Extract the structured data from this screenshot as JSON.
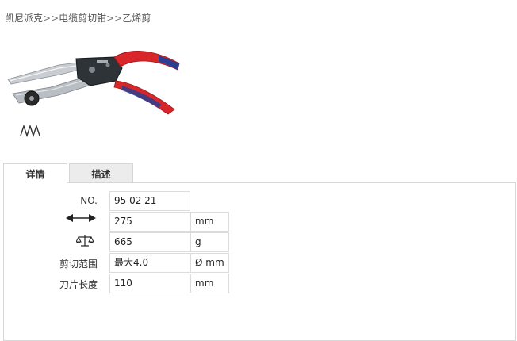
{
  "breadcrumb": {
    "items": [
      "凯尼派克",
      "电缆剪切钳",
      "乙烯剪"
    ],
    "separator": ">>"
  },
  "product_image": {
    "icon": "vinyl-shears-product-photo"
  },
  "spring_icon": {
    "icon": "spring-icon"
  },
  "tabs": [
    {
      "label": "详情",
      "active": true
    },
    {
      "label": "描述",
      "active": false
    }
  ],
  "specs": [
    {
      "label": "NO.",
      "label_icon": "",
      "value": "95 02 21",
      "unit": ""
    },
    {
      "label": "",
      "label_icon": "length-arrow-icon",
      "value": "275",
      "unit": "mm"
    },
    {
      "label": "",
      "label_icon": "weight-scale-icon",
      "value": "665",
      "unit": "g"
    },
    {
      "label": "剪切范围",
      "label_icon": "",
      "value": "最大4.0",
      "unit": "Ø mm"
    },
    {
      "label": "刀片长度",
      "label_icon": "",
      "value": "110",
      "unit": "mm"
    }
  ],
  "colors": {
    "handle_red": "#d8262a",
    "handle_blue": "#2a3f8f",
    "tab_inactive": "#ececec",
    "border": "#d6d6d6"
  }
}
